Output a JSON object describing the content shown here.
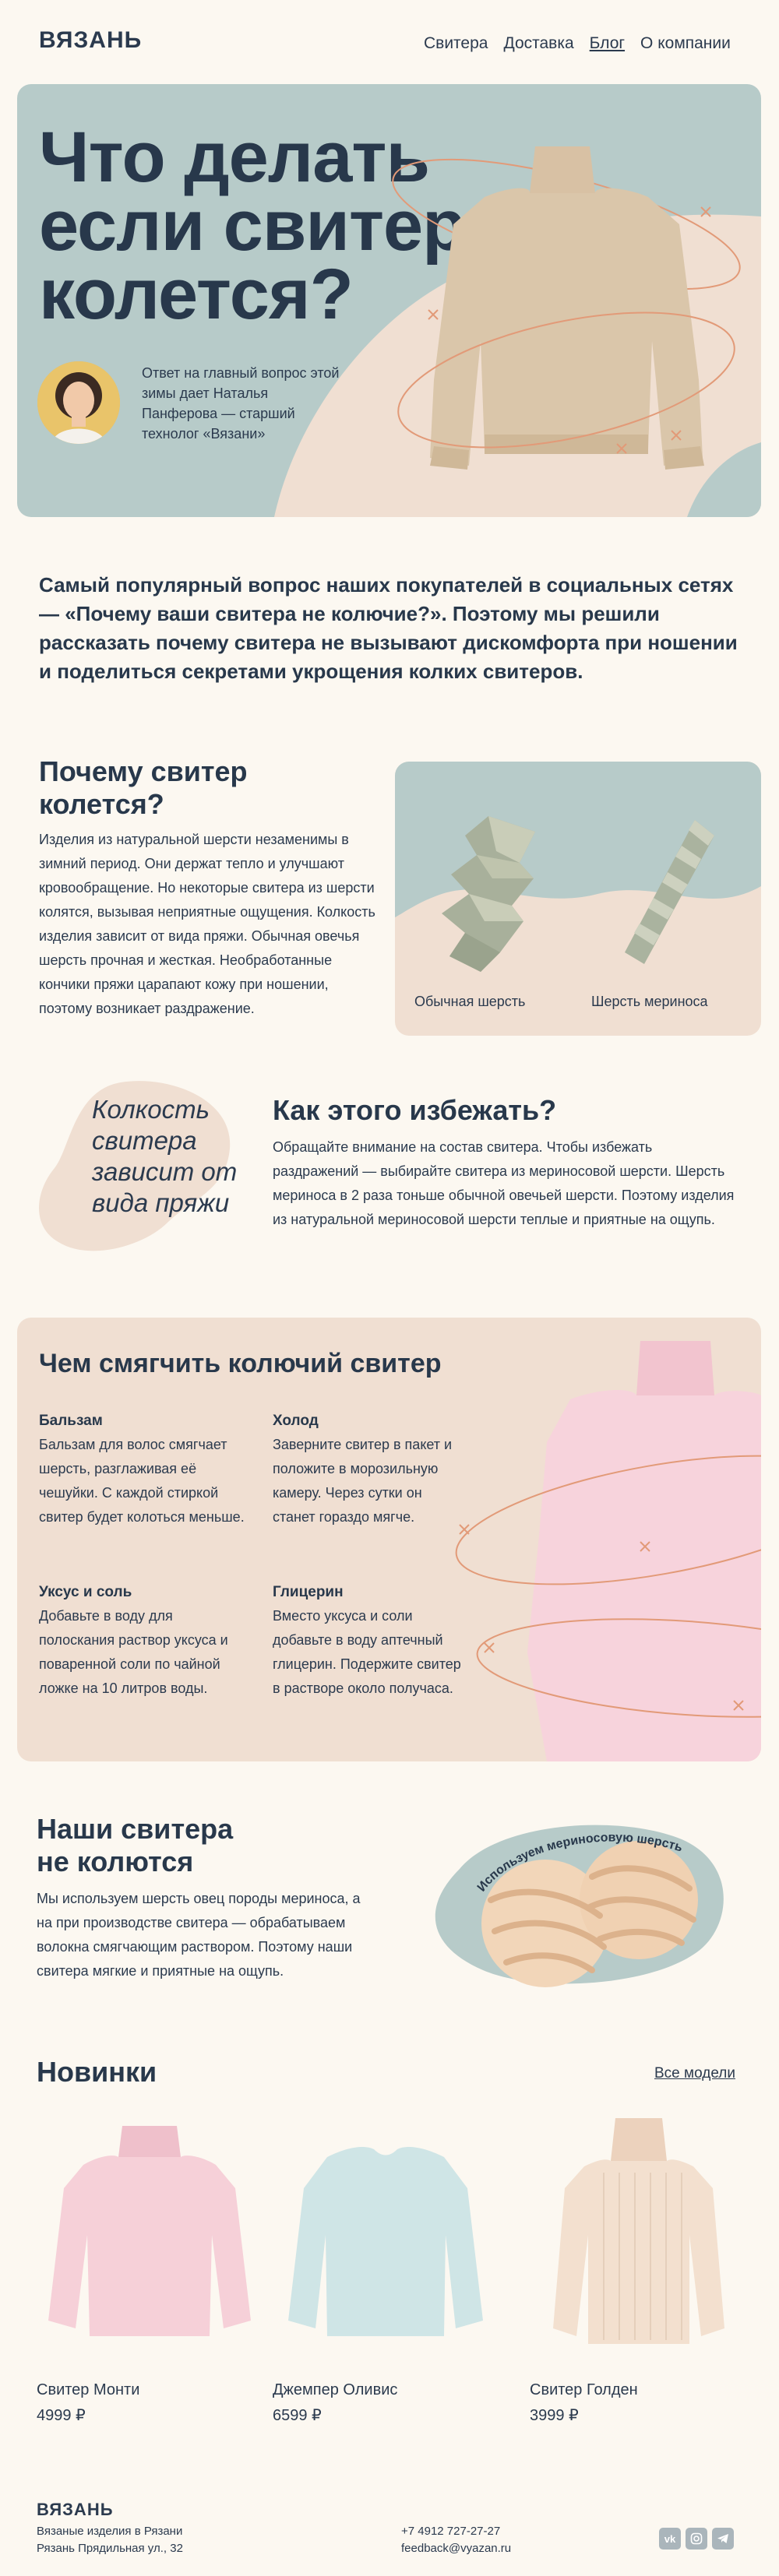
{
  "header": {
    "logo": "ВЯЗАНЬ",
    "nav": [
      "Свитера",
      "Доставка",
      "Блог",
      "О компании"
    ]
  },
  "hero": {
    "title_lines": [
      "Что делать",
      "если свитер",
      "колется?"
    ],
    "description": "Ответ на главный вопрос этой зимы дает Наталья Панферова — старший технолог «Вязани»"
  },
  "lead": "Самый популярный вопрос наших покупателей в социальных сетях — «Почему ваши свитера не колючие?». Поэтому мы решили рассказать почему свитера не вызывают дискомфорта при ношении и поделиться секретами укрощения колких свитеров.",
  "why": {
    "title_lines": [
      "Почему свитер",
      "колется?"
    ],
    "text": "Изделия из натуральной шерсти незаменимы в зимний период. Они держат тепло и улучшают кровообращение. Но некоторые свитера из шерсти колятся, вызывая неприятные ощущения. Колкость изделия зависит от вида пряжи. Обычная овечья шерсть прочная и жесткая. Необработанные кончики пряжи царапают кожу при ношении, поэтому возникает раздражение.",
    "caption_regular": "Обычная шерсть",
    "caption_merino": "Шерсть мериноса"
  },
  "avoid": {
    "quote": "Колкость свитера зависит от вида пряжи",
    "title": "Как этого избежать?",
    "text": "Обращайте внимание на состав свитера. Чтобы избежать раздражений — выбирайте свитера из мериносовой шерсти. Шерсть мериноса в 2 раза тоньше обычной овечьей шерсти. Поэтому изделия из натуральной мериносовой шерсти теплые и приятные на ощупь."
  },
  "soften": {
    "title": "Чем смягчить колючий свитер",
    "items": [
      {
        "title": "Бальзам",
        "text": "Бальзам для волос смягчает шерсть, разглаживая её чешуйки. С каждой стиркой свитер будет колоться меньше."
      },
      {
        "title": "Холод",
        "text": "Заверните свитер в пакет и положите в морозильную камеру. Через сутки он станет гораздо мягче."
      },
      {
        "title": "Уксус и соль",
        "text": "Добавьте в воду для полоскания раствор уксуса и поваренной соли по чайной ложке на 10 литров воды."
      },
      {
        "title": "Глицерин",
        "text": "Вместо уксуса и соли добавьте в воду аптечный глицерин. Подержите свитер в растворе около получаса."
      }
    ]
  },
  "ours": {
    "title_lines": [
      "Наши свитера",
      "не колются"
    ],
    "text": "Мы используем шерсть овец породы мериноса, а на при производстве свитера — обрабатываем волокна смягчающим раствором. Поэтому наши свитера мягкие и приятные на ощупь.",
    "badge_text": "Используем мериносовую шерсть"
  },
  "new": {
    "title": "Новинки",
    "all_link": "Все модели",
    "products": [
      {
        "name": "Свитер Монти",
        "price": "4999 ₽",
        "color": "#f4cfd6"
      },
      {
        "name": "Джемпер Оливис",
        "price": "6599 ₽",
        "color": "#c9e1e2"
      },
      {
        "name": "Свитер Голден",
        "price": "3999 ₽",
        "color": "#f1dccb"
      }
    ]
  },
  "footer": {
    "logo": "ВЯЗАНЬ",
    "line1": "Вязаные изделия в Рязани",
    "line2": "Рязань Прядильная ул., 32",
    "phone": "+7 4912 727-27-27",
    "email": "feedback@vyazan.ru",
    "socials": [
      "vk-icon",
      "instagram-icon",
      "telegram-icon"
    ]
  },
  "colors": {
    "background": "#fcf8f1",
    "dark_text": "#28384b",
    "teal": "#b7cbc9",
    "peach": "#f0dfd2",
    "accent_orange": "#e29a78"
  }
}
